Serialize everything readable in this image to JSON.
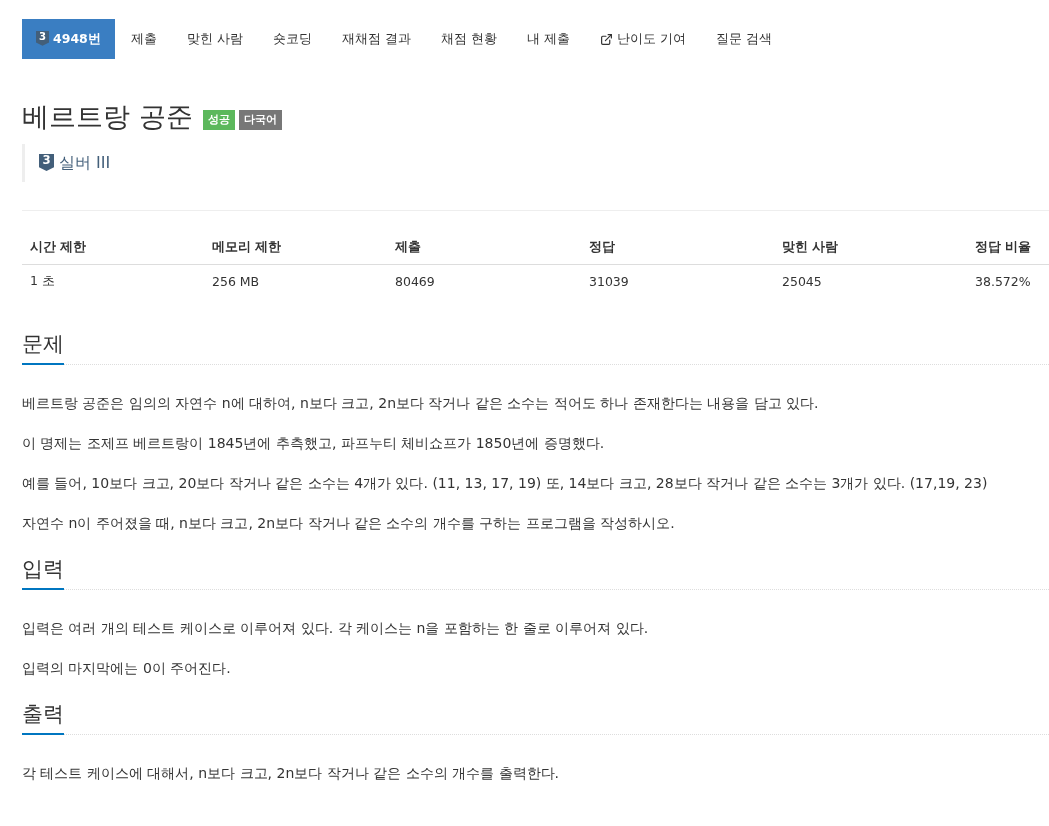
{
  "tabs": [
    {
      "kind": "problem",
      "badge": "3",
      "label": "4948번",
      "selected": true
    },
    {
      "kind": "link",
      "label": "제출",
      "selected": false
    },
    {
      "kind": "link",
      "label": "맞힌 사람",
      "selected": false
    },
    {
      "kind": "link",
      "label": "숏코딩",
      "selected": false
    },
    {
      "kind": "link",
      "label": "재채점 결과",
      "selected": false
    },
    {
      "kind": "link",
      "label": "채점 현황",
      "selected": false
    },
    {
      "kind": "link",
      "label": "내 제출",
      "selected": false
    },
    {
      "kind": "external",
      "label": "난이도 기여",
      "selected": false
    },
    {
      "kind": "link",
      "label": "질문 검색",
      "selected": false
    }
  ],
  "problem": {
    "title": "베르트랑 공준",
    "labels": [
      {
        "text": "성공",
        "color": "#5cb85c"
      },
      {
        "text": "다국어",
        "color": "#777777"
      }
    ],
    "tier": {
      "badge": "3",
      "name": "실버 III"
    }
  },
  "info_table": {
    "columns": [
      "시간 제한",
      "메모리 제한",
      "제출",
      "정답",
      "맞힌 사람",
      "정답 비율"
    ],
    "rows": [
      [
        "1 초",
        "256 MB",
        "80469",
        "31039",
        "25045",
        "38.572%"
      ]
    ]
  },
  "sections": [
    {
      "heading": "문제",
      "paragraphs": [
        "베르트랑 공준은 임의의 자연수 n에 대하여, n보다 크고, 2n보다 작거나 같은 소수는 적어도 하나 존재한다는 내용을 담고 있다.",
        "이 명제는 조제프 베르트랑이 1845년에 추측했고, 파프누티 체비쇼프가 1850년에 증명했다.",
        "예를 들어, 10보다 크고, 20보다 작거나 같은 소수는 4개가 있다. (11, 13, 17, 19) 또, 14보다 크고, 28보다 작거나 같은 소수는 3개가 있다. (17,19, 23)",
        "자연수 n이 주어졌을 때, n보다 크고, 2n보다 작거나 같은 소수의 개수를 구하는 프로그램을 작성하시오."
      ]
    },
    {
      "heading": "입력",
      "paragraphs": [
        "입력은 여러 개의 테스트 케이스로 이루어져 있다. 각 케이스는 n을 포함하는 한 줄로 이루어져 있다.",
        "입력의 마지막에는 0이 주어진다."
      ]
    },
    {
      "heading": "출력",
      "paragraphs": [
        "각 테스트 케이스에 대해서, n보다 크고, 2n보다 작거나 같은 소수의 개수를 출력한다."
      ]
    }
  ]
}
